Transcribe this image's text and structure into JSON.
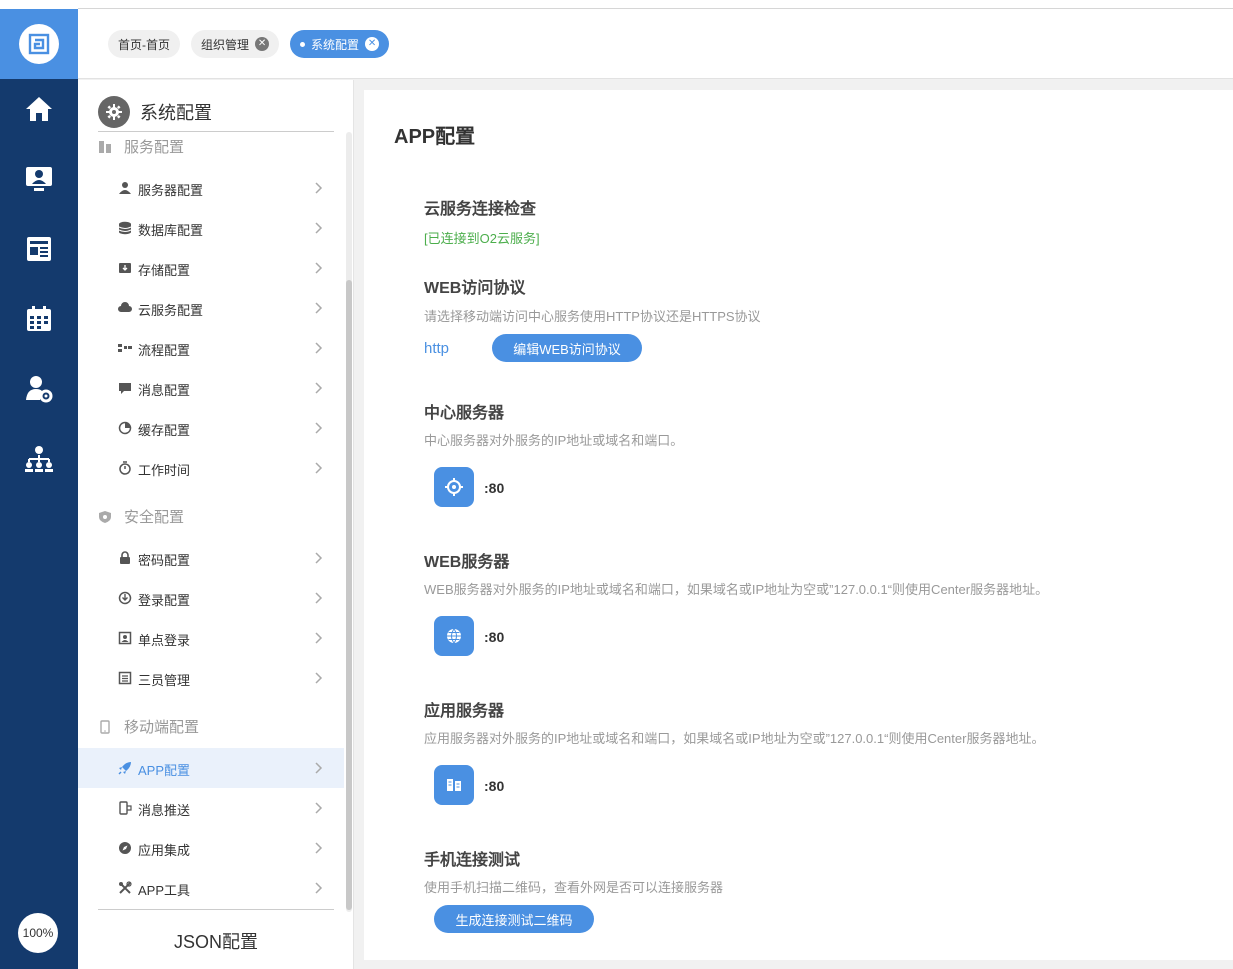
{
  "rail": {
    "zoom": "100%",
    "items": [
      "home-icon",
      "monitor-user-icon",
      "news-icon",
      "calendar-icon",
      "user-gear-icon",
      "org-chart-icon"
    ]
  },
  "tabs": [
    {
      "label": "首页-首页",
      "closable": false
    },
    {
      "label": "组织管理",
      "closable": true
    },
    {
      "label": "系统配置",
      "closable": true,
      "active": true
    }
  ],
  "sidebar": {
    "title": "系统配置",
    "groups": [
      {
        "label": "服务配置",
        "items": [
          {
            "label": "服务器配置",
            "icon": "server-user-icon"
          },
          {
            "label": "数据库配置",
            "icon": "database-icon"
          },
          {
            "label": "存储配置",
            "icon": "storage-icon"
          },
          {
            "label": "云服务配置",
            "icon": "cloud-icon"
          },
          {
            "label": "流程配置",
            "icon": "flow-icon"
          },
          {
            "label": "消息配置",
            "icon": "message-icon"
          },
          {
            "label": "缓存配置",
            "icon": "pie-icon"
          },
          {
            "label": "工作时间",
            "icon": "timer-icon"
          }
        ]
      },
      {
        "label": "安全配置",
        "items": [
          {
            "label": "密码配置",
            "icon": "lock-icon"
          },
          {
            "label": "登录配置",
            "icon": "login-icon"
          },
          {
            "label": "单点登录",
            "icon": "badge-icon"
          },
          {
            "label": "三员管理",
            "icon": "list-icon"
          }
        ]
      },
      {
        "label": "移动端配置",
        "items": [
          {
            "label": "APP配置",
            "icon": "rocket-icon",
            "active": true
          },
          {
            "label": "消息推送",
            "icon": "phone-push-icon"
          },
          {
            "label": "应用集成",
            "icon": "compass-icon"
          },
          {
            "label": "APP工具",
            "icon": "tools-icon"
          }
        ]
      }
    ],
    "json_link": "JSON配置"
  },
  "main": {
    "title": "APP配置",
    "cloud": {
      "title": "云服务连接检查",
      "status": "[已连接到O2云服务]"
    },
    "web_protocol": {
      "title": "WEB访问协议",
      "desc": "请选择移动端访问中心服务使用HTTP协议还是HTTPS协议",
      "value": "http",
      "button": "编辑WEB访问协议"
    },
    "center_server": {
      "title": "中心服务器",
      "desc": "中心服务器对外服务的IP地址或域名和端口。",
      "port": ":80"
    },
    "web_server": {
      "title": "WEB服务器",
      "desc": "WEB服务器对外服务的IP地址或域名和端口，如果域名或IP地址为空或”127.0.0.1“则使用Center服务器地址。",
      "port": ":80"
    },
    "app_server": {
      "title": "应用服务器",
      "desc": "应用服务器对外服务的IP地址或域名和端口，如果域名或IP地址为空或”127.0.0.1“则使用Center服务器地址。",
      "port": ":80"
    },
    "mobile_test": {
      "title": "手机连接测试",
      "desc": "使用手机扫描二维码，查看外网是否可以连接服务器",
      "button": "生成连接测试二维码"
    }
  },
  "colors": {
    "rail": "#143a6d",
    "accent": "#4a90e2",
    "ok": "#4cae4c"
  }
}
